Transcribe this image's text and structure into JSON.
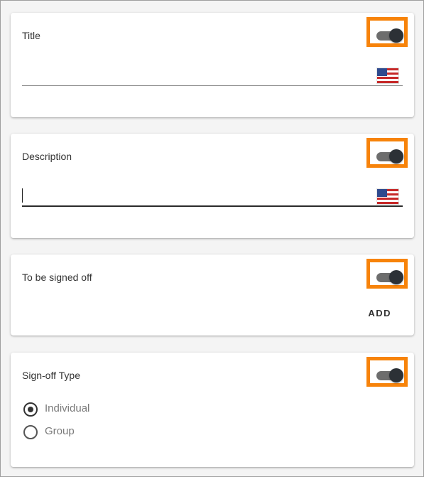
{
  "colors": {
    "highlight": "#f7830a",
    "toggle_track": "#6d6d6d",
    "toggle_thumb": "#2c3136"
  },
  "cards": {
    "title": {
      "label": "Title",
      "toggle_on": true,
      "input_value": "",
      "flag_icon": "us-flag-icon"
    },
    "description": {
      "label": "Description",
      "toggle_on": true,
      "input_value": "",
      "flag_icon": "us-flag-icon"
    },
    "signed_off": {
      "label": "To be signed off",
      "toggle_on": true,
      "add_label": "ADD"
    },
    "signoff_type": {
      "label": "Sign-off Type",
      "toggle_on": true,
      "options": [
        {
          "label": "Individual",
          "selected": true
        },
        {
          "label": "Group",
          "selected": false
        }
      ]
    }
  }
}
